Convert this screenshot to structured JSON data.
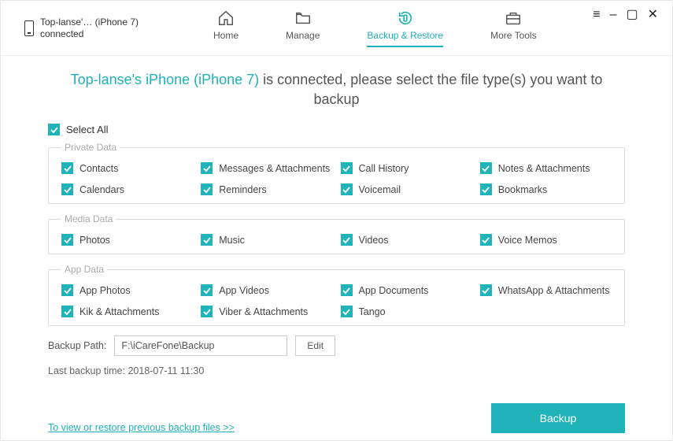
{
  "device": {
    "name_short": "Top-lanse'… (iPhone 7)",
    "status": "connected"
  },
  "nav": {
    "home": "Home",
    "manage": "Manage",
    "backup": "Backup & Restore",
    "more": "More Tools"
  },
  "window": {
    "menu": "≡",
    "min": "–",
    "max": "▢",
    "close": "✕"
  },
  "headline": {
    "device_name": "Top-lanse's iPhone (iPhone 7)",
    "rest": " is connected, please select the file type(s) you want to backup"
  },
  "select_all": "Select All",
  "sections": {
    "private": {
      "legend": "Private Data",
      "items": [
        "Contacts",
        "Messages & Attachments",
        "Call History",
        "Notes & Attachments",
        "Calendars",
        "Reminders",
        "Voicemail",
        "Bookmarks"
      ]
    },
    "media": {
      "legend": "Media Data",
      "items": [
        "Photos",
        "Music",
        "Videos",
        "Voice Memos"
      ]
    },
    "app": {
      "legend": "App Data",
      "items": [
        "App Photos",
        "App Videos",
        "App Documents",
        "WhatsApp & Attachments",
        "Kik & Attachments",
        "Viber & Attachments",
        "Tango"
      ]
    }
  },
  "path": {
    "label": "Backup Path:",
    "value": "F:\\iCareFone\\Backup",
    "edit": "Edit"
  },
  "last_backup": "Last backup time: 2018-07-11 11:30",
  "link_prev": "To view or restore previous backup files >>",
  "backup_btn": "Backup"
}
